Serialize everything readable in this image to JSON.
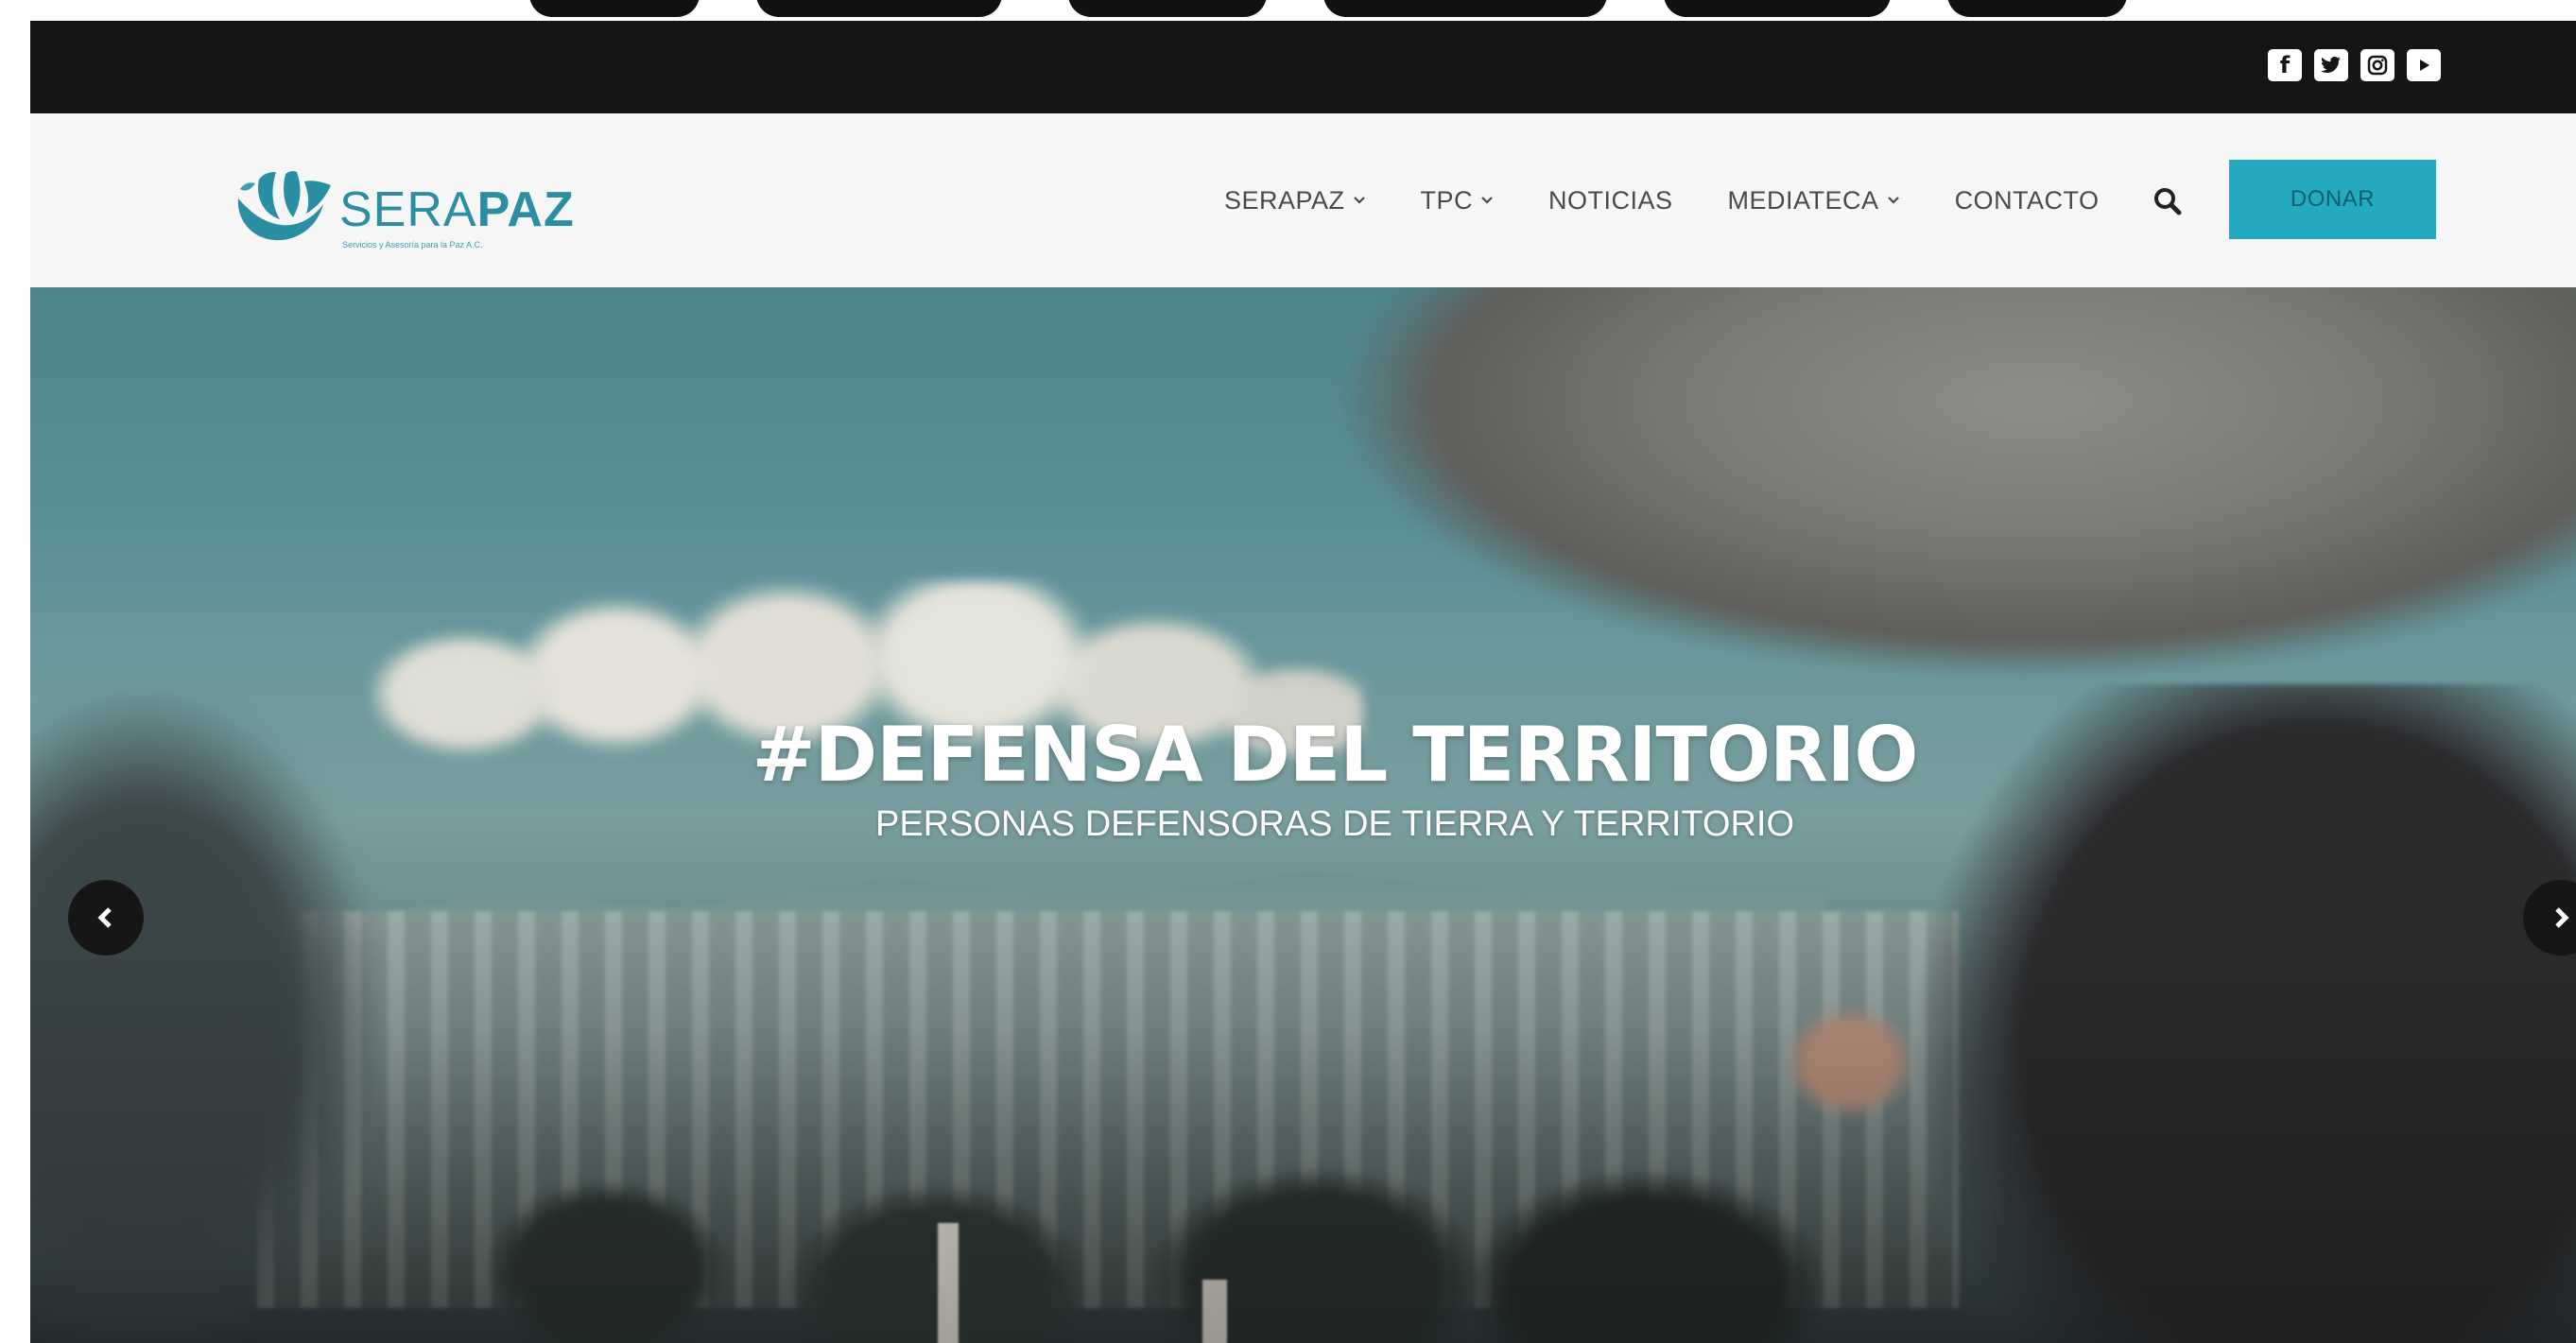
{
  "social": {
    "icons": [
      "facebook-icon",
      "twitter-icon",
      "instagram-icon",
      "youtube-icon"
    ]
  },
  "brand": {
    "name_part1": "SERA",
    "name_part2": "PAZ",
    "tagline": "Servicios y Asesoría para la Paz A.C.",
    "color": "#2a8fa2"
  },
  "nav": {
    "items": [
      {
        "label": "SERAPAZ",
        "has_dropdown": true
      },
      {
        "label": "TPC",
        "has_dropdown": true
      },
      {
        "label": "NOTICIAS",
        "has_dropdown": false
      },
      {
        "label": "MEDIATECA",
        "has_dropdown": true
      },
      {
        "label": "CONTACTO",
        "has_dropdown": false
      }
    ],
    "search_icon": "search-icon",
    "donate_label": "DONAR",
    "donate_color": "#23a9c0"
  },
  "hero": {
    "title": "#DEFENSA DEL TERRITORIO",
    "subtitle": "PERSONAS DEFENSORAS DE TIERRA Y TERRITORIO",
    "prev_icon": "chevron-left-icon",
    "next_icon": "chevron-right-icon"
  }
}
